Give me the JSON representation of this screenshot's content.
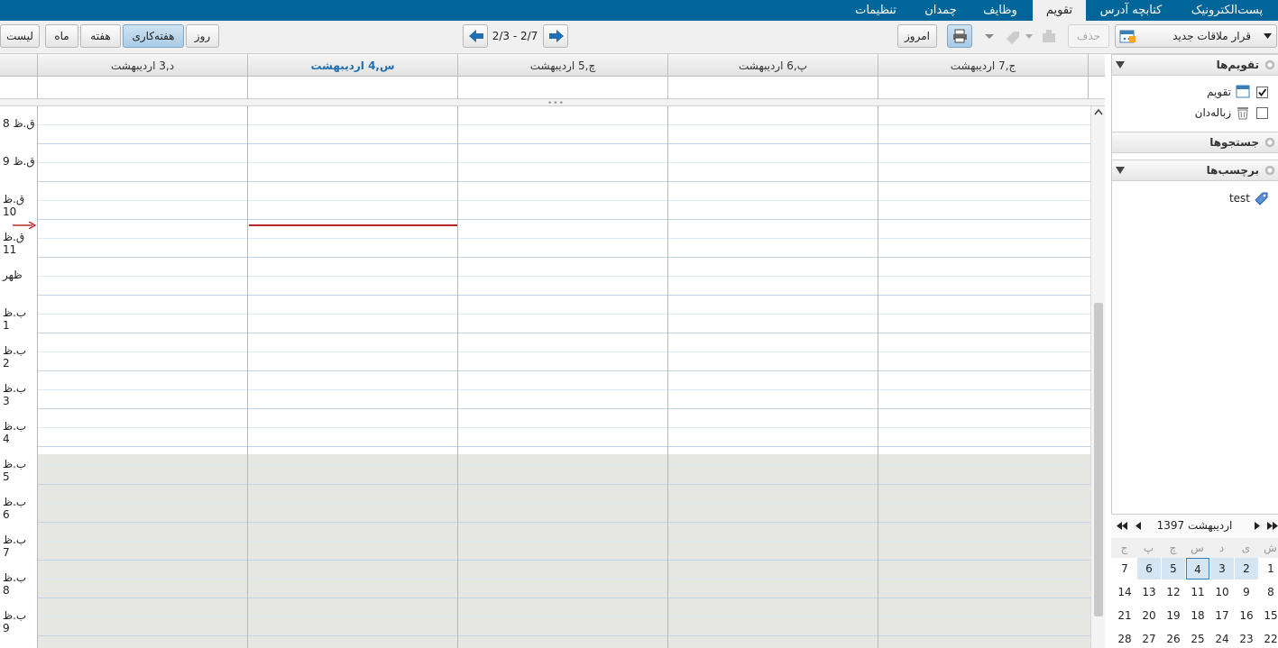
{
  "top_tabs": [
    {
      "label": "پست‌الکترونیک",
      "active": false
    },
    {
      "label": "کتابچه آدرس",
      "active": false
    },
    {
      "label": "تقویم",
      "active": true
    },
    {
      "label": "وظایف",
      "active": false
    },
    {
      "label": "چمدان",
      "active": false
    },
    {
      "label": "تنظیمات",
      "active": false
    }
  ],
  "toolbar": {
    "new_appointment": "قرار ملاقات جدید",
    "delete": "حذف",
    "today": "امروز",
    "range": "2/3 - 2/7",
    "views": {
      "day": "روز",
      "workweek": "هفته‌کاری",
      "week": "هفته",
      "month": "ماه",
      "list": "لیست"
    },
    "active_view": "workweek"
  },
  "days": [
    {
      "label": "ج,7 اردیبهشت",
      "today": false
    },
    {
      "label": "پ,6 اردیبهشت",
      "today": false
    },
    {
      "label": "چ,5 اردیبهشت",
      "today": false
    },
    {
      "label": "س,4 اردیبهشت",
      "today": true
    },
    {
      "label": "د,3 اردیبهشت",
      "today": false
    }
  ],
  "hours": [
    "ق.ظ 8",
    "ق.ظ 9",
    "ق.ظ 10",
    "ق.ظ 11",
    "ظهر",
    "ب.ظ 1",
    "ب.ظ 2",
    "ب.ظ 3",
    "ب.ظ 4",
    "ب.ظ 5",
    "ب.ظ 6",
    "ب.ظ 7",
    "ب.ظ 8",
    "ب.ظ 9"
  ],
  "sidebar": {
    "calendars_title": "تقویم‌ها",
    "calendars": [
      {
        "label": "تقویم",
        "checked": true,
        "icon": "calendar-icon"
      },
      {
        "label": "زباله‌دان",
        "checked": false,
        "icon": "trash-icon"
      }
    ],
    "searches_title": "جستجوها",
    "tags_title": "برچسب‌ها",
    "tags": [
      {
        "label": "test",
        "icon": "tag-icon"
      }
    ]
  },
  "mini_calendar": {
    "title": "اردیبهشت 1397",
    "weekdays": [
      "ش",
      "ی",
      "د",
      "س",
      "چ",
      "پ",
      "ج"
    ],
    "weeks": [
      [
        "1",
        "2",
        "3",
        "4",
        "5",
        "6",
        "7"
      ],
      [
        "8",
        "9",
        "10",
        "11",
        "12",
        "13",
        "14"
      ],
      [
        "15",
        "16",
        "17",
        "18",
        "19",
        "20",
        "21"
      ],
      [
        "22",
        "23",
        "24",
        "25",
        "26",
        "27",
        "28"
      ]
    ],
    "today": "4",
    "highlight_week": 0
  },
  "colors": {
    "top_bar": "#006699",
    "now_line": "#b5252a",
    "today_text": "#1f6fb2",
    "selection": "#d4e5f3"
  }
}
